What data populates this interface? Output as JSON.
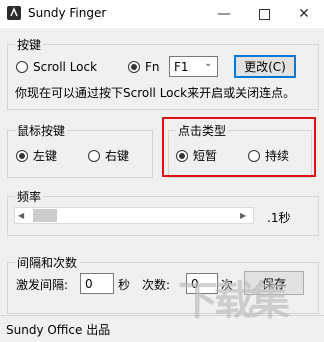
{
  "window": {
    "title": "Sundy Finger"
  },
  "hotkey_group": {
    "label": "按键",
    "radio_scroll_lock": "Scroll Lock",
    "radio_fn": "Fn",
    "fn_value": "F1",
    "change_button": "更改(C)",
    "info_text": "你现在可以通过按下Scroll Lock来开启或关闭连点。"
  },
  "mouse_group": {
    "label": "鼠标按键",
    "left_label": "左键",
    "right_label": "右键",
    "selected": "left"
  },
  "click_type_group": {
    "label": "点击类型",
    "short_label": "短暂",
    "hold_label": "持续",
    "selected": "short"
  },
  "frequency_group": {
    "label": "频率",
    "value_text": ".1秒",
    "slider_position_fraction": 0.1
  },
  "interval_group": {
    "label": "间隔和次数",
    "trigger_interval_label": "激发间隔:",
    "trigger_interval_value": "0",
    "seconds_unit": "秒",
    "count_label": "次数:",
    "count_value": "0",
    "count_unit": "次",
    "save_button": "保存"
  },
  "status_bar": {
    "text": "Sundy Office 出品"
  },
  "watermark_text": "下载集"
}
